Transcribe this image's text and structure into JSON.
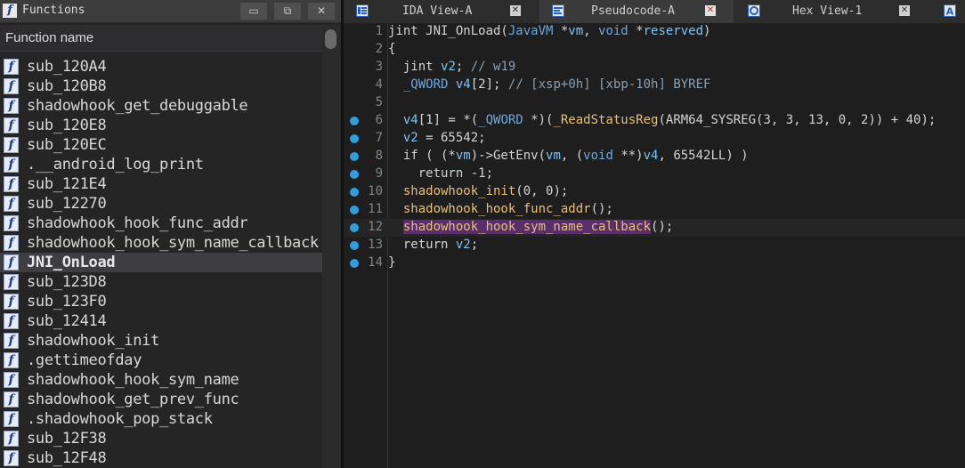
{
  "functions_panel": {
    "title": "Functions",
    "column_header": "Function name",
    "window_buttons": {
      "restore": "▭",
      "float": "⧉",
      "close": "✕"
    },
    "items": [
      {
        "name": "sub_120A4"
      },
      {
        "name": "sub_120B8"
      },
      {
        "name": "shadowhook_get_debuggable"
      },
      {
        "name": "sub_120E8"
      },
      {
        "name": "sub_120EC"
      },
      {
        "name": ".__android_log_print"
      },
      {
        "name": "sub_121E4"
      },
      {
        "name": "sub_12270"
      },
      {
        "name": "shadowhook_hook_func_addr"
      },
      {
        "name": "shadowhook_hook_sym_name_callback"
      },
      {
        "name": "JNI_OnLoad",
        "selected": true
      },
      {
        "name": "sub_123D8"
      },
      {
        "name": "sub_123F0"
      },
      {
        "name": "sub_12414"
      },
      {
        "name": "shadowhook_init"
      },
      {
        "name": ".gettimeofday"
      },
      {
        "name": "shadowhook_hook_sym_name"
      },
      {
        "name": "shadowhook_get_prev_func"
      },
      {
        "name": ".shadowhook_pop_stack"
      },
      {
        "name": "sub_12F38"
      },
      {
        "name": "sub_12F48"
      }
    ]
  },
  "tabs": [
    {
      "label": "IDA View-A",
      "icon": "ida-view-icon",
      "active": false
    },
    {
      "label": "Pseudocode-A",
      "icon": "pseudocode-icon",
      "active": true
    },
    {
      "label": "Hex View-1",
      "icon": "hex-view-icon",
      "active": false
    },
    {
      "label": "",
      "icon": "structures-icon",
      "active": false
    }
  ],
  "code": {
    "lines": [
      {
        "no": "1",
        "bp": false,
        "text": "jint JNI_OnLoad(JavaVM *vm, void *reserved)"
      },
      {
        "no": "2",
        "bp": false,
        "text": "{"
      },
      {
        "no": "3",
        "bp": false,
        "text": "  jint v2; // w19"
      },
      {
        "no": "4",
        "bp": false,
        "text": "  _QWORD v4[2]; // [xsp+0h] [xbp-10h] BYREF"
      },
      {
        "no": "5",
        "bp": false,
        "text": ""
      },
      {
        "no": "6",
        "bp": true,
        "text": "  v4[1] = *(_QWORD *)(_ReadStatusReg(ARM64_SYSREG(3, 3, 13, 0, 2)) + 40);"
      },
      {
        "no": "7",
        "bp": true,
        "text": "  v2 = 65542;"
      },
      {
        "no": "8",
        "bp": true,
        "text": "  if ( (*vm)->GetEnv(vm, (void **)v4, 65542LL) )"
      },
      {
        "no": "9",
        "bp": true,
        "text": "    return -1;"
      },
      {
        "no": "10",
        "bp": true,
        "text": "  shadowhook_init(0, 0);"
      },
      {
        "no": "11",
        "bp": true,
        "text": "  shadowhook_hook_func_addr();"
      },
      {
        "no": "12",
        "bp": true,
        "text": "  shadowhook_hook_sym_name_callback();"
      },
      {
        "no": "13",
        "bp": true,
        "text": "  return v2;"
      },
      {
        "no": "14",
        "bp": true,
        "text": "}"
      }
    ],
    "current_line": "12",
    "highlight_word": "shadowhook_hook_sym_name_callback"
  },
  "colors": {
    "breakpoint": "#2f9fe0",
    "highlight": "#5a2d6b",
    "background": "#1e1e1e"
  }
}
